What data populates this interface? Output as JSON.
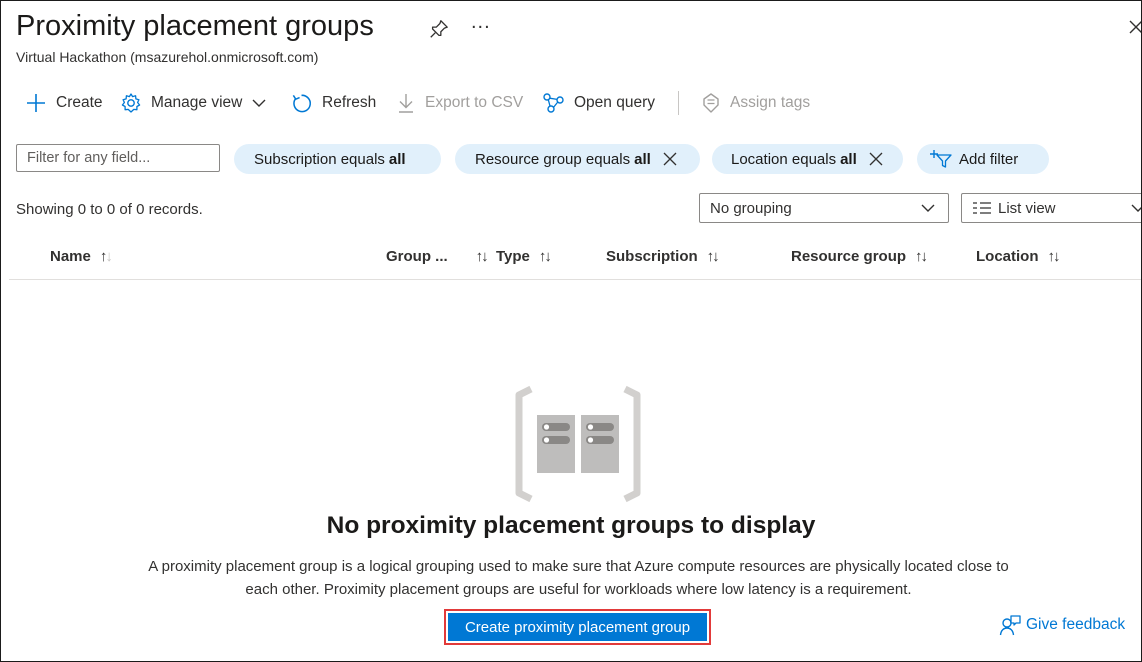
{
  "header": {
    "title": "Proximity placement groups",
    "subtitle": "Virtual Hackathon (msazurehol.onmicrosoft.com)",
    "more": "..."
  },
  "toolbar": {
    "create": "Create",
    "manage_view": "Manage view",
    "refresh": "Refresh",
    "export_csv": "Export to CSV",
    "open_query": "Open query",
    "assign_tags": "Assign tags"
  },
  "filters": {
    "placeholder": "Filter for any field...",
    "pills": [
      {
        "label": "Subscription equals",
        "value": "all"
      },
      {
        "label": "Resource group equals",
        "value": "all"
      },
      {
        "label": "Location equals",
        "value": "all"
      }
    ],
    "add_filter": "Add filter"
  },
  "records": {
    "showing": "Showing 0 to 0 of 0 records.",
    "grouping": "No grouping",
    "view": "List view"
  },
  "table": {
    "columns": [
      "Name",
      "Group ...",
      "Type",
      "Subscription",
      "Resource group",
      "Location"
    ]
  },
  "empty": {
    "title": "No proximity placement groups to display",
    "description": "A proximity placement group is a logical grouping used to make sure that Azure compute resources are physically located close to each other. Proximity placement groups are useful for workloads where low latency is a requirement.",
    "cta": "Create proximity placement group"
  },
  "feedback": "Give feedback",
  "colors": {
    "accent": "#0078d4",
    "pill_bg": "#e1f0fb",
    "highlight": "#e23a3a"
  }
}
